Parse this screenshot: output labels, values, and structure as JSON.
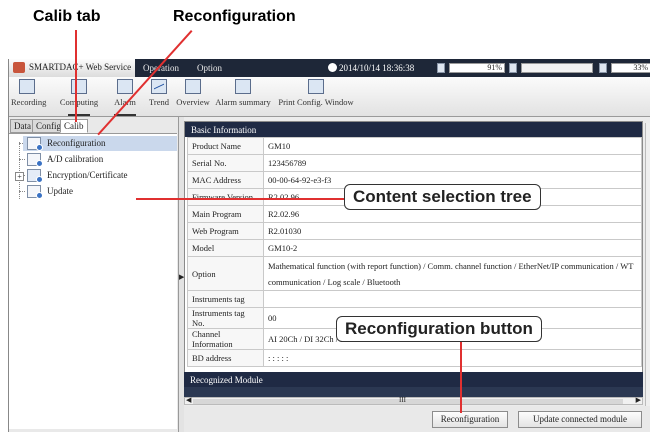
{
  "callouts": {
    "calib_tab": "Calib tab",
    "reconfiguration": "Reconfiguration",
    "content_tree": "Content selection tree",
    "reconfig_button": "Reconfiguration button"
  },
  "topbar": {
    "service_tab": "SMARTDAC+ Web Service",
    "operation_tab": "Operation",
    "option_tab": "Option",
    "datetime": "2014/10/14 18:36:38",
    "gauge1": "91%",
    "gauge2": "33%"
  },
  "toolbar": {
    "items": [
      {
        "label": "Recording"
      },
      {
        "label": "Computing"
      },
      {
        "label": "Alarm"
      },
      {
        "label": "Trend"
      },
      {
        "label": "Overview"
      },
      {
        "label": "Alarm summary"
      },
      {
        "label": "Print Config. Window"
      }
    ]
  },
  "left_tabs": [
    "Data",
    "Config.",
    "Calib"
  ],
  "tree": {
    "items": [
      {
        "label": "Reconfiguration"
      },
      {
        "label": "A/D calibration"
      },
      {
        "label": "Encryption/Certificate"
      },
      {
        "label": "Update"
      }
    ]
  },
  "basic_info": {
    "heading": "Basic Information",
    "rows": [
      {
        "key": "Product Name",
        "value": "GM10"
      },
      {
        "key": "Serial No.",
        "value": "123456789"
      },
      {
        "key": "MAC Address",
        "value": "00-00-64-92-e3-f3"
      },
      {
        "key": "Firmware Version",
        "value": "R2.02.96"
      },
      {
        "key": "Main Program",
        "value": "R2.02.96"
      },
      {
        "key": "Web Program",
        "value": "R2.01030"
      },
      {
        "key": "Model",
        "value": "GM10-2"
      },
      {
        "key": "Option",
        "value": "Mathematical function (with report function) / Comm. channel function / EtherNet/IP communication / WT communication / Log scale / Bluetooth"
      },
      {
        "key": "Instruments tag",
        "value": ""
      },
      {
        "key": "Instruments tag No.",
        "value": "00"
      },
      {
        "key": "Channel Information",
        "value": "AI 20Ch / DI 32Ch / DO 32Ch"
      },
      {
        "key": "BD address",
        "value": ": : : : :"
      }
    ]
  },
  "module": {
    "heading": "Recognized Module",
    "scroll_mark": "III"
  },
  "buttons": {
    "reconfiguration": "Reconfiguration",
    "update_module": "Update connected module"
  }
}
